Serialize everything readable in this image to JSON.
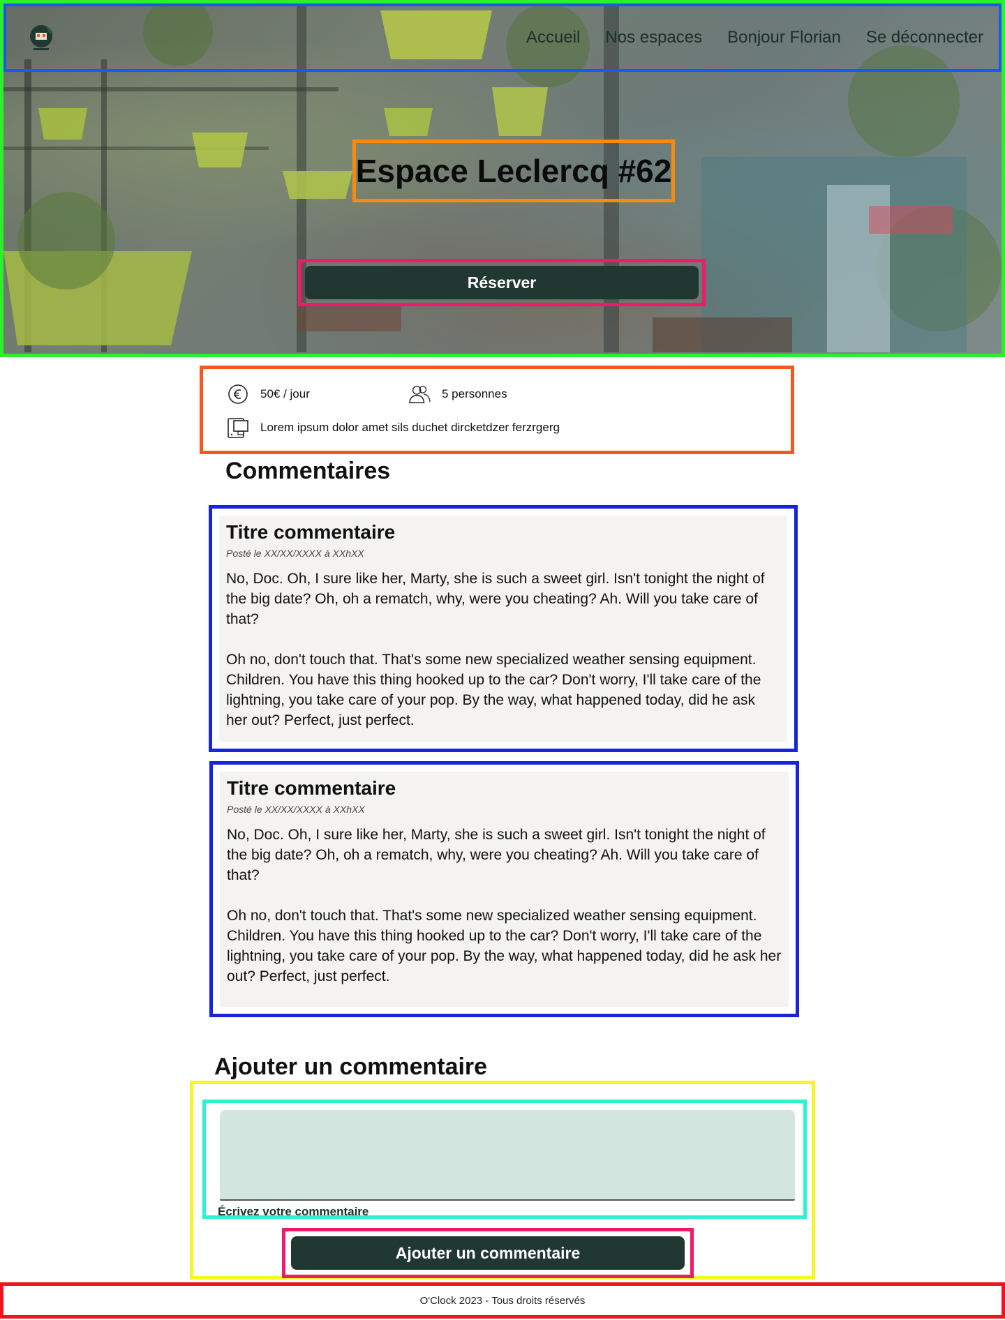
{
  "nav": {
    "logo_alt": "Coworking logo",
    "links": [
      "Accueil",
      "Nos espaces",
      "Bonjour Florian",
      "Se déconnecter"
    ]
  },
  "hero": {
    "title": "Espace Leclercq #62",
    "reserve_label": "Réserver"
  },
  "info": {
    "price": "50€ / jour",
    "capacity": "5 personnes",
    "equipment": "Lorem ipsum dolor amet sils duchet dircketdzer ferzrgerg",
    "icons": [
      "euro-icon",
      "people-icon",
      "devices-icon"
    ]
  },
  "comments": {
    "section_title": "Commentaires",
    "items": [
      {
        "title": "Titre commentaire",
        "date": "Posté le XX/XX/XXXX à XXhXX",
        "paragraphs": [
          "No, Doc. Oh, I sure like her, Marty, she is such a sweet girl. Isn't tonight the night of the big date? Oh, oh a rematch, why, were you cheating? Ah. Will you take care of that?",
          "Oh no, don't touch that. That's some new specialized weather sensing equipment. Children. You have this thing hooked up to the car? Don't worry, I'll take care of the lightning, you take care of your pop. By the way, what happened today, did he ask her out? Perfect, just perfect."
        ]
      },
      {
        "title": "Titre commentaire",
        "date": "Posté le XX/XX/XXXX à XXhXX",
        "paragraphs": [
          "No, Doc. Oh, I sure like her, Marty, she is such a sweet girl. Isn't tonight the night of the big date? Oh, oh a rematch, why, were you cheating? Ah. Will you take care of that?",
          "Oh no, don't touch that. That's some new specialized weather sensing equipment. Children. You have this thing hooked up to the car? Don't worry, I'll take care of the lightning, you take care of your pop. By the way, what happened today, did he ask her out? Perfect, just perfect."
        ]
      }
    ]
  },
  "add_comment": {
    "title": "Ajouter un commentaire",
    "textarea_value": "",
    "field_label": "Écrivez votre commentaire",
    "submit_label": "Ajouter un commentaire"
  },
  "footer": {
    "text": "O'Clock 2023 - Tous droits réservés"
  },
  "colors": {
    "primary_button": "#213832",
    "textarea_bg": "#d2e5df",
    "comment_bg": "#f4f3f1"
  }
}
